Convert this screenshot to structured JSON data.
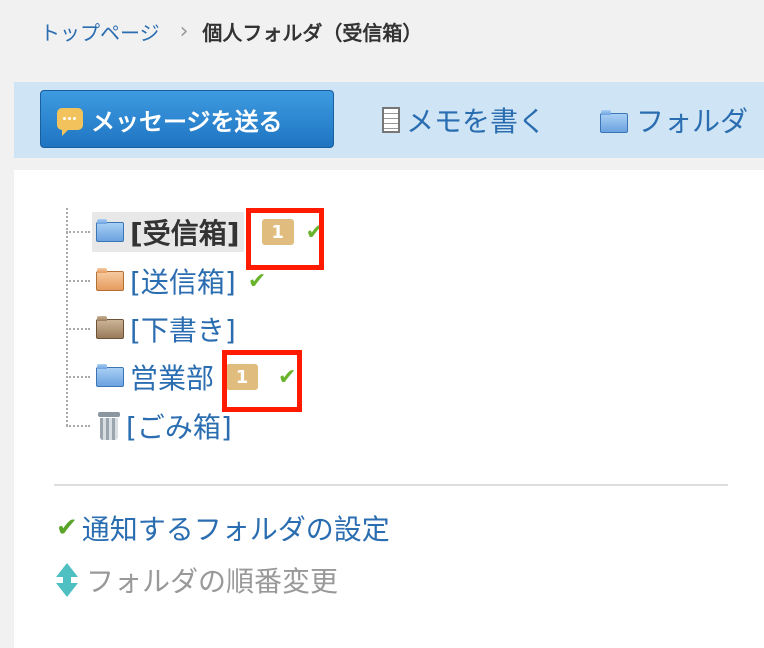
{
  "breadcrumb": {
    "home": "トップページ",
    "separator": "›",
    "current": "個人フォルダ（受信箱）"
  },
  "toolbar": {
    "send_label": "メッセージを送る",
    "memo_label": "メモを書く",
    "folder_label": "フォルダ"
  },
  "folders": [
    {
      "label": "[受信箱]",
      "badge": "1",
      "icon": "folder-blue",
      "selected": true,
      "notify": true
    },
    {
      "label": "[送信箱]",
      "icon": "folder-orange",
      "notify": true
    },
    {
      "label": "[下書き]",
      "icon": "folder-brown"
    },
    {
      "label": "営業部",
      "badge": "1",
      "icon": "folder-blue",
      "notify": true
    },
    {
      "label": "[ごみ箱]",
      "icon": "trash-icon"
    }
  ],
  "actions": {
    "notify_settings": "通知するフォルダの設定",
    "reorder": "フォルダの順番変更"
  },
  "colors": {
    "link": "#2a6db0",
    "highlight_box": "#ff1a00",
    "badge": "#e0bd7e",
    "check": "#6ab42d",
    "toolbar_bg": "#cfe4f4"
  }
}
